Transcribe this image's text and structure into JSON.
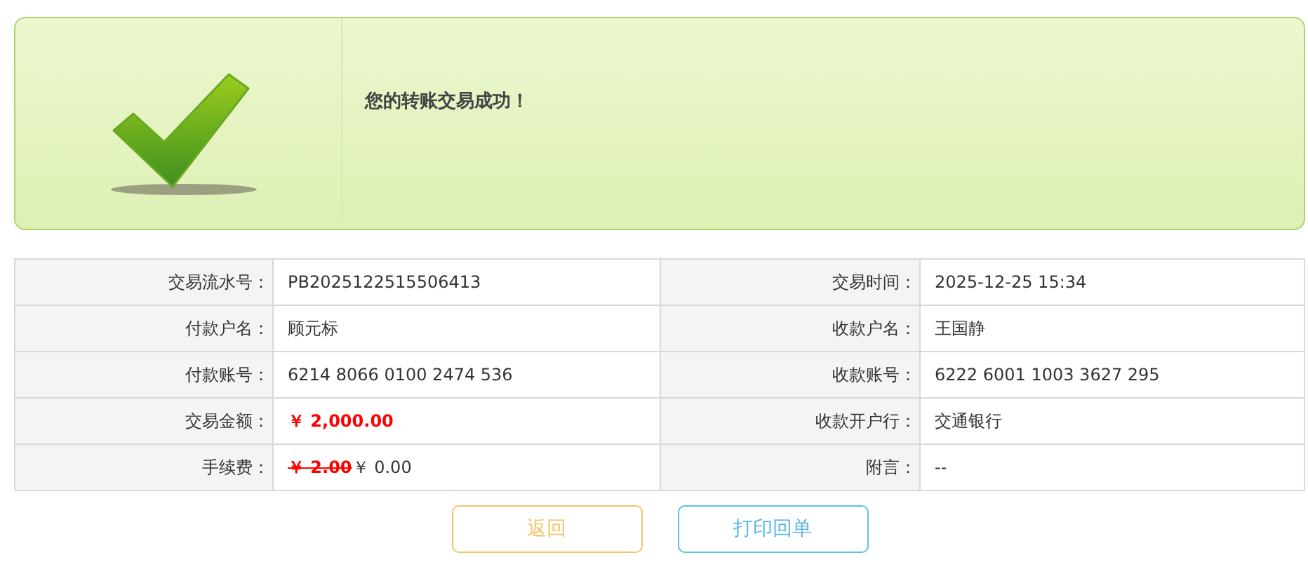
{
  "banner": {
    "message": "您的转账交易成功！"
  },
  "details": {
    "rows": [
      [
        {
          "label": "交易流水号：",
          "value": "PB2025122515506413",
          "kind": "plain"
        },
        {
          "label": "交易时间：",
          "value": "2025-12-25 15:34",
          "kind": "plain"
        }
      ],
      [
        {
          "label": "付款户名：",
          "value": "顾元标",
          "kind": "plain"
        },
        {
          "label": "收款户名：",
          "value": "王国静",
          "kind": "plain"
        }
      ],
      [
        {
          "label": "付款账号：",
          "value": "6214 8066 0100 2474 536",
          "kind": "plain"
        },
        {
          "label": "收款账号：",
          "value": "6222 6001 1003 3627 295",
          "kind": "plain"
        }
      ],
      [
        {
          "label": "交易金额：",
          "value": "￥ 2,000.00",
          "kind": "amount"
        },
        {
          "label": "收款开户行：",
          "value": "交通银行",
          "kind": "plain"
        }
      ],
      [
        {
          "label": "手续费：",
          "old_value": "￥ 2.00",
          "value": "￥ 0.00",
          "kind": "fee"
        },
        {
          "label": "附言：",
          "value": "--",
          "kind": "plain"
        }
      ]
    ]
  },
  "buttons": [
    {
      "label": "返回",
      "kind": "back"
    },
    {
      "label": "打印回单",
      "kind": "print"
    }
  ]
}
